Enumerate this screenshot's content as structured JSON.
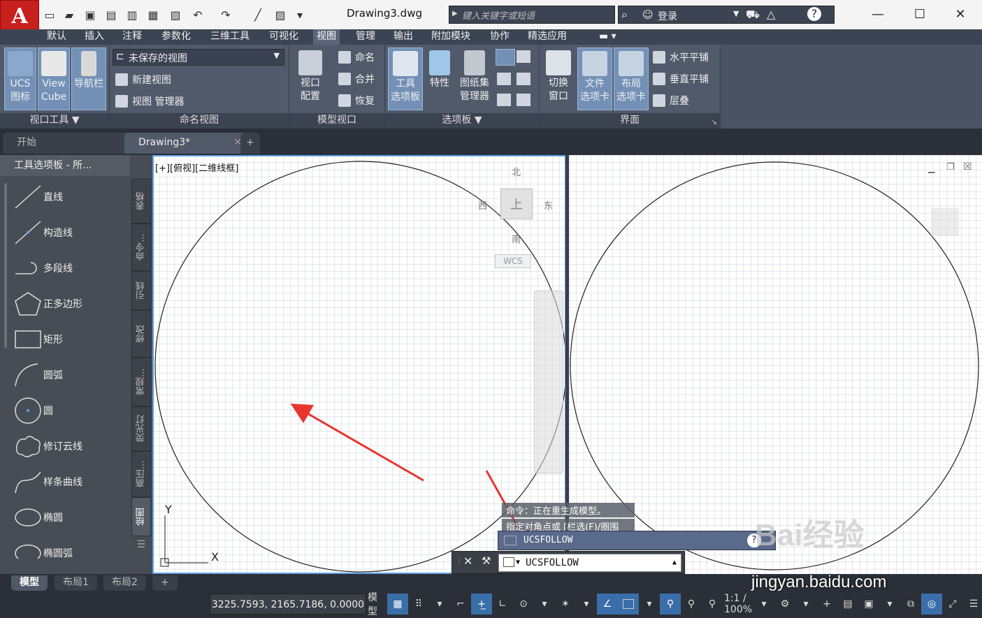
{
  "window": {
    "doc_title": "Drawing3.dwg",
    "app_logo": "A",
    "search_placeholder": "键入关键字或短语",
    "login_label": "登录"
  },
  "menu_tabs": [
    "默认",
    "插入",
    "注释",
    "参数化",
    "三维工具",
    "可视化",
    "视图",
    "管理",
    "输出",
    "附加模块",
    "协作",
    "精选应用"
  ],
  "active_menu_tab": "视图",
  "ribbon": {
    "viewport_tools": {
      "title": "视口工具 ▼",
      "buttons": [
        {
          "label_1": "UCS",
          "label_2": "图标"
        },
        {
          "label_1": "View",
          "label_2": "Cube"
        },
        {
          "label_1": "导航栏",
          "label_2": ""
        }
      ]
    },
    "named_views": {
      "title": "命名视图",
      "combo_value": "未保存的视图",
      "items": [
        "新建视图",
        "视图 管理器"
      ]
    },
    "model_viewports": {
      "title": "模型视口",
      "big_label_1": "视口",
      "big_label_2": "配置",
      "items": [
        "命名",
        "合并",
        "恢复"
      ]
    },
    "palettes": {
      "title": "选项板 ▼",
      "buttons": [
        {
          "label_1": "工具",
          "label_2": "选项板"
        },
        {
          "label_1": "特性",
          "label_2": ""
        },
        {
          "label_1": "图纸集",
          "label_2": "管理器"
        }
      ]
    },
    "interface": {
      "title": "界面",
      "buttons": [
        {
          "label_1": "切换",
          "label_2": "窗口"
        },
        {
          "label_1": "文件",
          "label_2": "选项卡"
        },
        {
          "label_1": "布局",
          "label_2": "选项卡"
        }
      ],
      "items": [
        "水平平铺",
        "垂直平铺",
        "层叠"
      ]
    }
  },
  "file_tabs": [
    {
      "label": "开始"
    },
    {
      "label": "Drawing3*"
    }
  ],
  "tool_palette": {
    "title": "工具选项板 - 所...",
    "items": [
      "直线",
      "构造线",
      "多段线",
      "正多边形",
      "矩形",
      "圆弧",
      "圆",
      "修订云线",
      "样条曲线",
      "椭圆",
      "椭圆弧"
    ],
    "side_tabs": [
      "表格",
      "命令...",
      "引线",
      "修改",
      "常规...",
      "荧光灯",
      "高压...",
      "绘图"
    ]
  },
  "viewport": {
    "label": "[+][俯视][二维线框]",
    "compass": {
      "north": "北",
      "south": "南",
      "east": "东",
      "west": "西",
      "face": "上",
      "wcs": "WCS"
    },
    "axis_y": "Y",
    "axis_x": "X"
  },
  "command": {
    "history": [
      "命令：正在重生成模型。",
      "指定对角点或 [栏选(F)/圈围"
    ],
    "autocomplete": "UCSFOLLOW",
    "input_value": "UCSFOLLOW"
  },
  "layout_tabs": [
    "模型",
    "布局1",
    "布局2"
  ],
  "status": {
    "coords": "3225.7593, 2165.7186, 0.0000",
    "model": "模型",
    "scale": "1:1 / 100%"
  },
  "watermark": {
    "brand": "Bai经验",
    "url": "jingyan.baidu.com"
  },
  "colors": {
    "accent": "#5aa0e6",
    "arrow": "#e8352e",
    "ribbon": "#515a6b",
    "logo": "#c8201c"
  }
}
